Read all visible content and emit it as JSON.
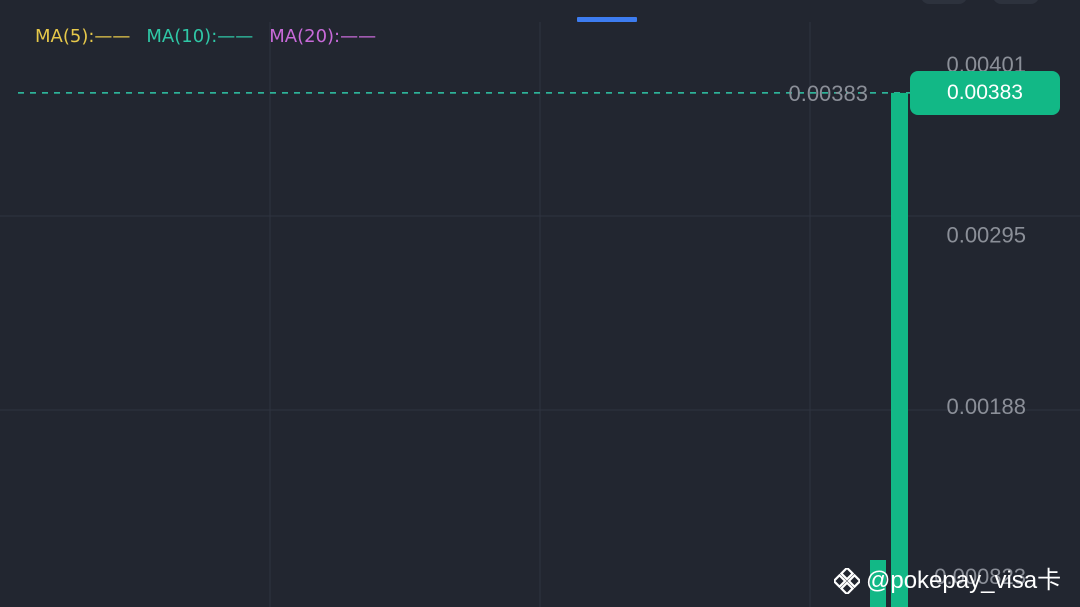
{
  "legend": {
    "ma5": "MA(5):——",
    "ma10": "MA(10):——",
    "ma20": "MA(20):——"
  },
  "colors": {
    "background": "#222630",
    "grid": "#2f3440",
    "axis_text": "#8b8f98",
    "ma5": "#e6c84a",
    "ma10": "#2fc7a6",
    "ma20": "#c86ad9",
    "up": "#12b886",
    "tab_indicator": "#3d7cf0"
  },
  "price_badge": "0.00383",
  "watermark": "@pokepay_visa卡",
  "chart_data": {
    "type": "candlestick",
    "y_axis": {
      "position": "right",
      "ticks": [
        "0.00401",
        "0.00295",
        "0.00188",
        "0.000823"
      ],
      "range": [
        0.0006,
        0.00416
      ]
    },
    "current_price": {
      "value": 0.00383,
      "label": "0.00383",
      "line_style": "dashed"
    },
    "candles": [
      {
        "open": 0.0006,
        "close": 0.00383,
        "high": 0.00383,
        "low": 0.0006
      }
    ],
    "grid": true
  }
}
